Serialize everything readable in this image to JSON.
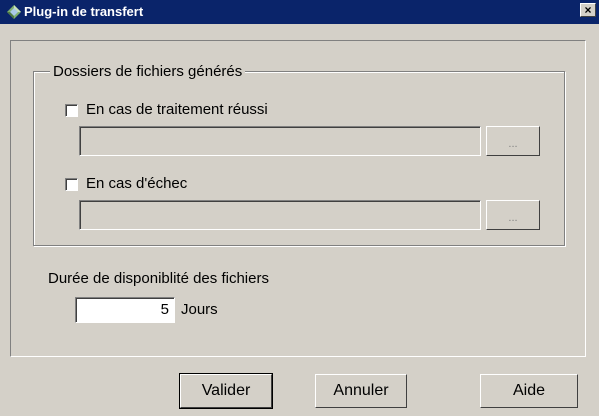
{
  "window": {
    "title": "Plug-in de transfert",
    "icon": "gem-icon",
    "close_label": "×"
  },
  "folders_group": {
    "legend": "Dossiers de fichiers générés",
    "success": {
      "label": "En cas de traitement réussi",
      "checked": false,
      "path": "",
      "browse_label": "..."
    },
    "failure": {
      "label": "En cas d'échec",
      "checked": false,
      "path": "",
      "browse_label": "..."
    }
  },
  "availability": {
    "label": "Durée de disponiblité des fichiers",
    "value": "5",
    "unit": "Jours"
  },
  "buttons": {
    "ok": "Valider",
    "cancel": "Annuler",
    "help": "Aide"
  },
  "colors": {
    "titlebar": "#0a246a",
    "face": "#d4d0c8"
  }
}
